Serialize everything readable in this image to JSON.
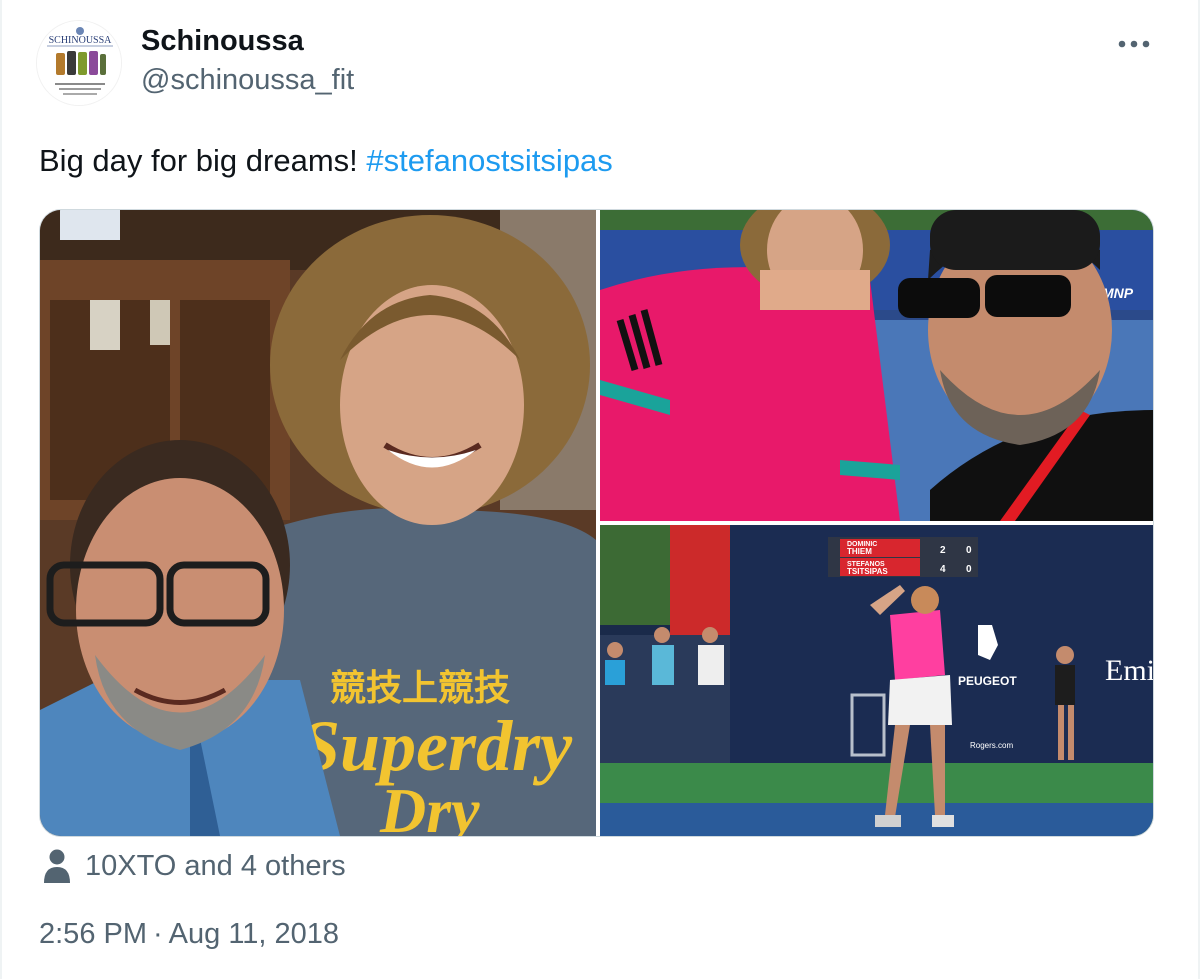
{
  "author": {
    "display_name": "Schinoussa",
    "handle": "@schinoussa_fit",
    "avatar_icon": "brand-logo-avatar",
    "avatar_logo_text": "SCHINOUSSA"
  },
  "tweet": {
    "text": "Big day for big dreams! ",
    "hashtag": "#stefanostsitsipas",
    "photos": [
      {
        "name": "selfie-backstage",
        "shirt_text_1": "競技上競技",
        "shirt_text_2": "Superdry",
        "shirt_text_3": "Dry"
      },
      {
        "name": "selfie-courtside",
        "banner_text": "MNP"
      },
      {
        "name": "match-serve",
        "score_player_1": "DOMINIC THIEM",
        "score_1_sets": "2",
        "score_1_games": "0",
        "score_player_2": "STEFANOS TSITSIPAS",
        "score_2_sets": "4",
        "score_2_games": "0",
        "banner_peugeot": "PEUGEOT",
        "banner_emirates": "Emir",
        "banner_rogers": "Rogers.com"
      }
    ]
  },
  "engagement": {
    "likes_text": "10XTO and 4 others"
  },
  "meta": {
    "time": "2:56 PM",
    "separator": "·",
    "date": "Aug 11, 2018"
  },
  "colors": {
    "link": "#1d9bf0",
    "secondary_text": "#536471",
    "primary_text": "#0f1419"
  },
  "icons": {
    "more": "more-horizontal-icon",
    "person": "person-icon"
  }
}
